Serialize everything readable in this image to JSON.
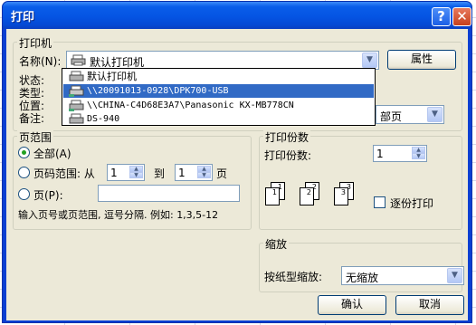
{
  "window": {
    "title": "打印",
    "help_label": "?",
    "close_label": "✕"
  },
  "printer_group": {
    "label": "打印机",
    "name_label": "名称(N):",
    "selected": "默认打印机",
    "properties_button": "属性",
    "status_label": "状态:",
    "type_label": "类型:",
    "location_label": "位置:",
    "comment_label": "备注:",
    "hidden_combo_tail": "部页",
    "dropdown_items": [
      {
        "label": "默认打印机",
        "selected": false
      },
      {
        "label": "\\\\20091013-0928\\DPK700-USB",
        "selected": true
      },
      {
        "label": "\\\\CHINA-C4D68E3A7\\Panasonic KX-MB778CN",
        "selected": false
      },
      {
        "label": "DS-940",
        "selected": false
      }
    ]
  },
  "page_range": {
    "label": "页范围",
    "all_label": "全部(A)",
    "range_label": "页码范围: 从",
    "from_value": "1",
    "to_label": "到",
    "to_value": "1",
    "page_unit": "页",
    "pages_label": "页(P):",
    "pages_value": "",
    "hint": "输入页号或页范围, 逗号分隔. 例如: 1,3,5-12"
  },
  "copies": {
    "label": "打印份数",
    "count_label": "打印份数:",
    "count_value": "1",
    "collate_label": "逐份打印",
    "collate_checked": false
  },
  "zoom": {
    "label": "缩放",
    "scale_label": "按纸型缩放:",
    "scale_value": "无缩放"
  },
  "buttons": {
    "ok": "确认",
    "cancel": "取消"
  }
}
